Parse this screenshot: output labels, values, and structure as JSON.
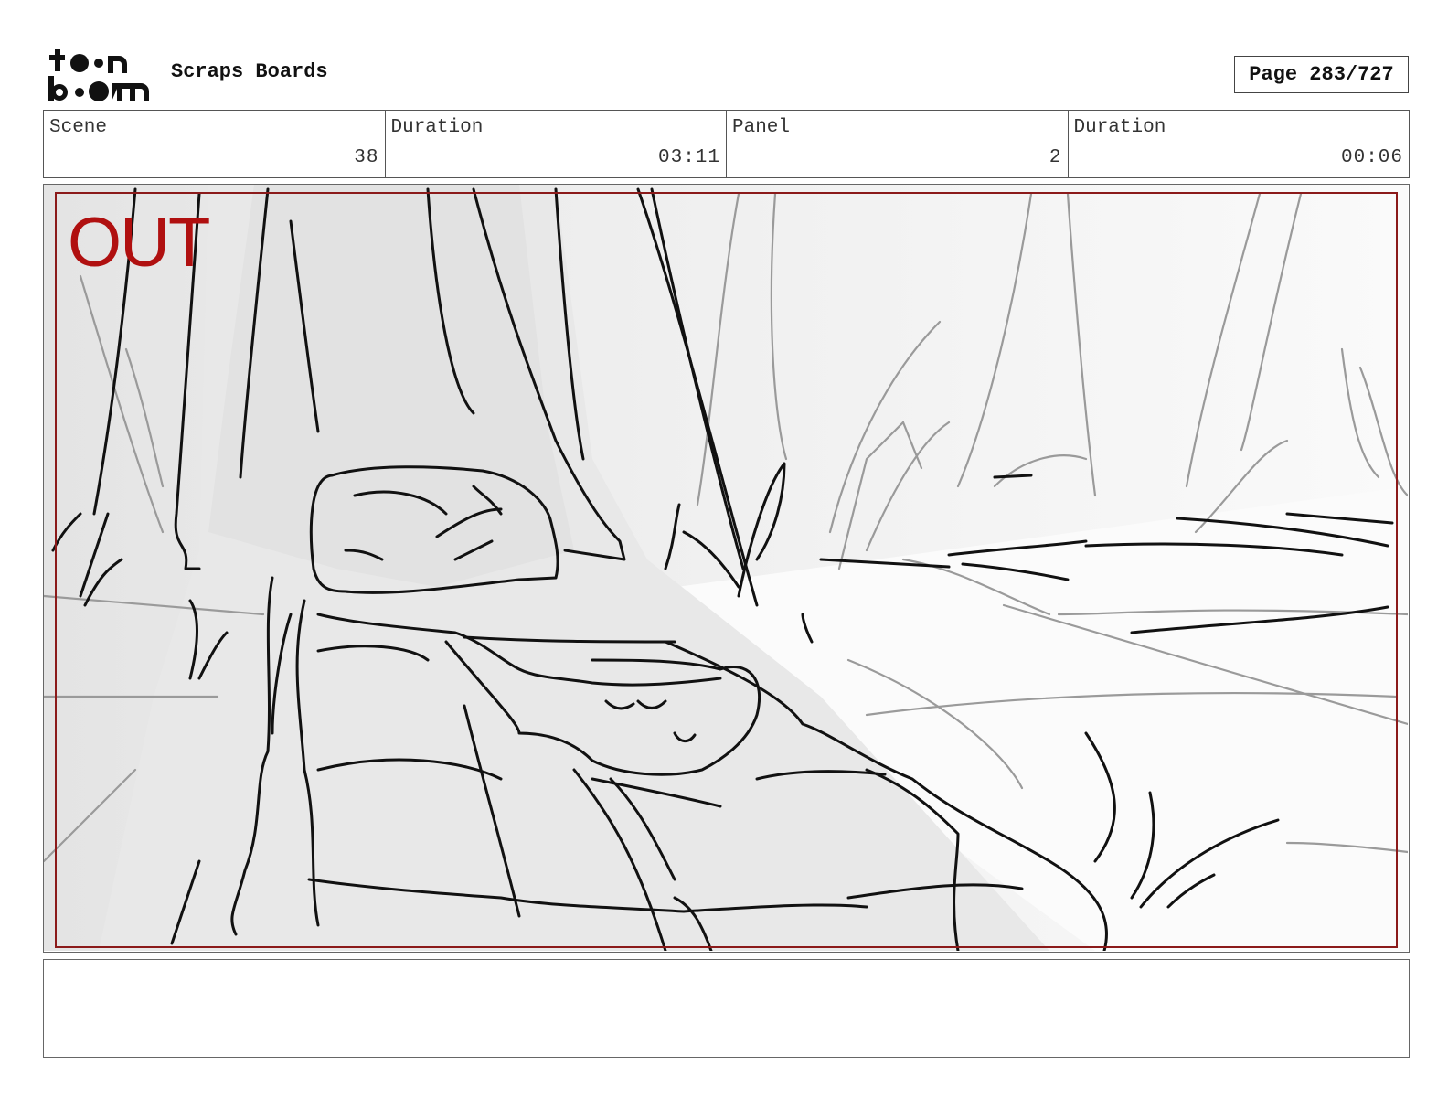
{
  "header": {
    "logo_text": "toon boom",
    "project_title": "Scraps Boards",
    "page_label": "Page 283/727"
  },
  "info": {
    "scene_label": "Scene",
    "scene_value": "38",
    "scene_duration_label": "Duration",
    "scene_duration_value": "03:11",
    "panel_label": "Panel",
    "panel_value": "2",
    "panel_duration_label": "Duration",
    "panel_duration_value": "00:06"
  },
  "panel": {
    "camera_tag": "OUT",
    "camera_tag_color": "#b01010",
    "frame_color": "#8b1a1a",
    "image_description": "rough storyboard sketch of a forest floor with a large tree trunk, a rock and roots, grass tufts"
  },
  "notes": {
    "text": ""
  }
}
